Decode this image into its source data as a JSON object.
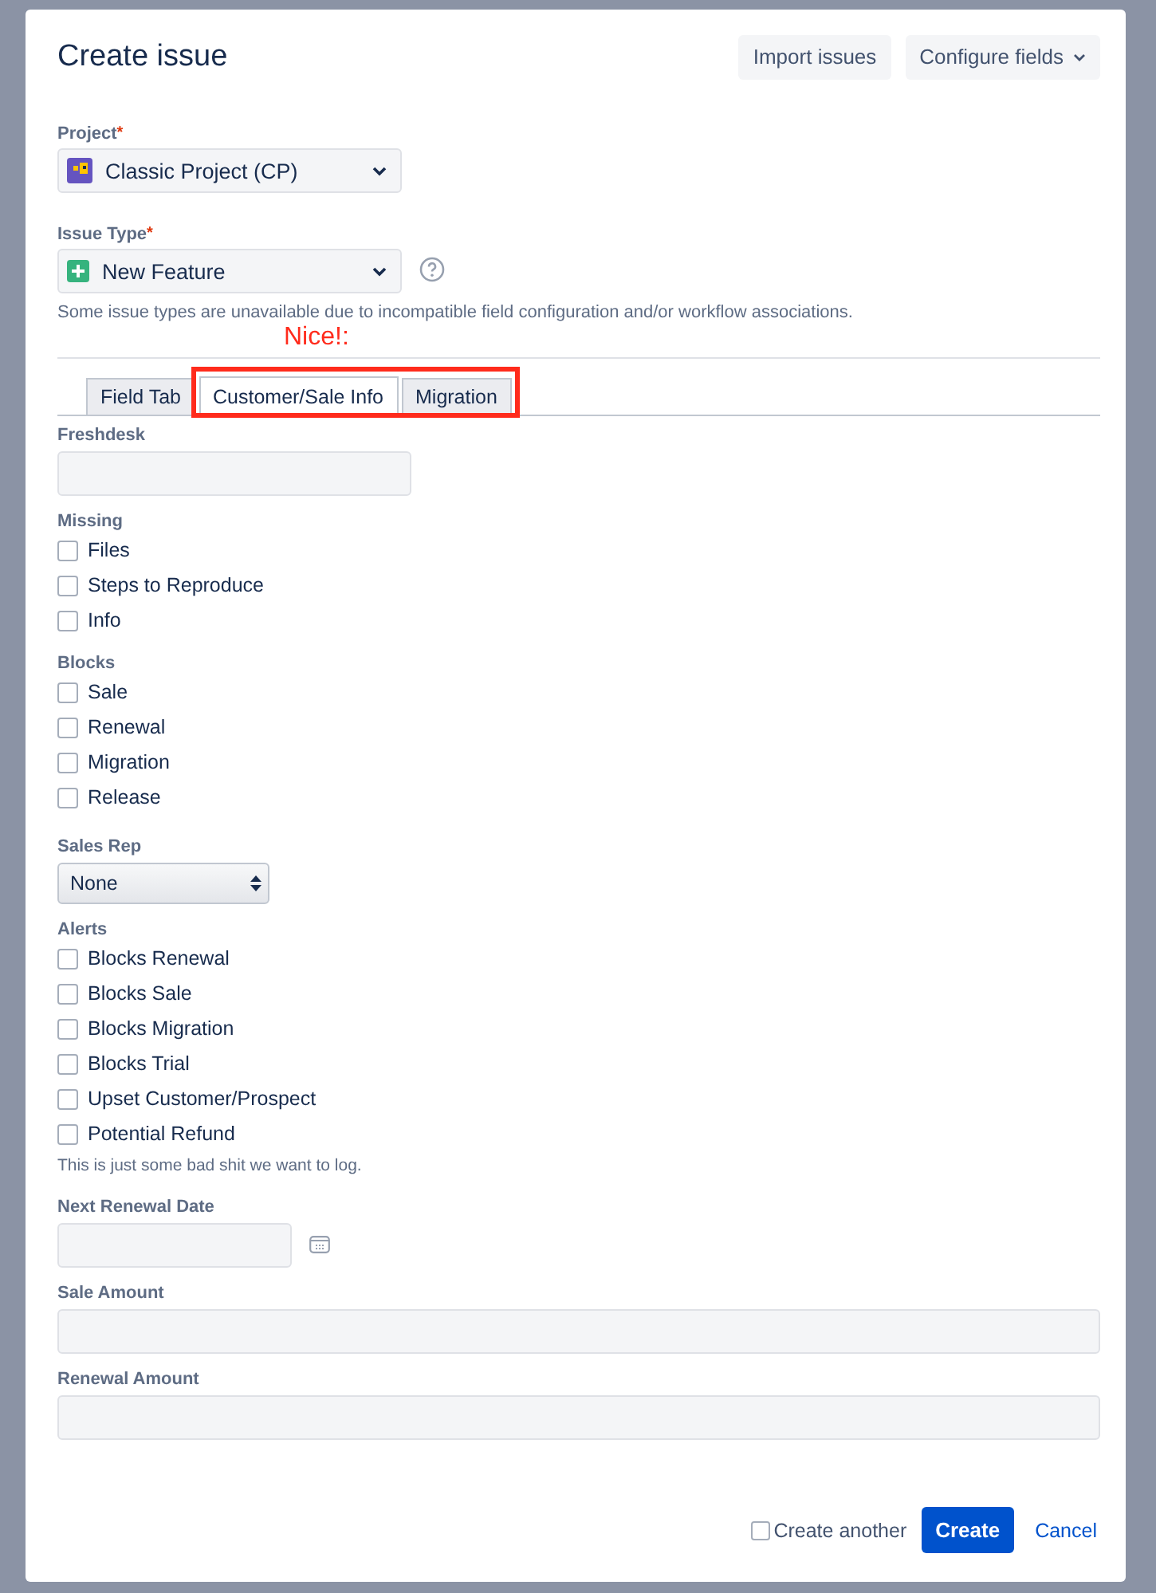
{
  "dialog": {
    "title": "Create issue",
    "header_buttons": [
      {
        "label": "Import issues",
        "dropdown": false
      },
      {
        "label": "Configure fields",
        "dropdown": true
      }
    ],
    "project": {
      "label": "Project",
      "required_mark": "*",
      "value": "Classic Project (CP)"
    },
    "issue_type": {
      "label": "Issue Type",
      "required_mark": "*",
      "value": "New Feature",
      "note": "Some issue types are unavailable due to incompatible field configuration and/or workflow associations."
    },
    "annotation": {
      "text": "Nice!:"
    },
    "tabs": [
      {
        "label": "Field Tab",
        "selected": false
      },
      {
        "label": "Customer/Sale Info",
        "selected": true
      },
      {
        "label": "Migration",
        "selected": false
      }
    ],
    "fields": [
      {
        "kind": "short_text",
        "label": "Freshdesk"
      },
      {
        "kind": "checkboxes",
        "label": "Missing",
        "options": [
          {
            "label": "Files",
            "checked": false
          },
          {
            "label": "Steps to Reproduce",
            "checked": false
          },
          {
            "label": "Info",
            "checked": false
          }
        ]
      },
      {
        "kind": "checkboxes",
        "label": "Blocks",
        "options": [
          {
            "label": "Sale",
            "checked": false
          },
          {
            "label": "Renewal",
            "checked": false
          },
          {
            "label": "Migration",
            "checked": false
          },
          {
            "label": "Release",
            "checked": false
          }
        ]
      },
      {
        "kind": "select",
        "label": "Sales Rep",
        "value": "None"
      },
      {
        "kind": "checkboxes",
        "label": "Alerts",
        "options": [
          {
            "label": "Blocks Renewal",
            "checked": false
          },
          {
            "label": "Blocks Sale",
            "checked": false
          },
          {
            "label": "Blocks Migration",
            "checked": false
          },
          {
            "label": "Blocks Trial",
            "checked": false
          },
          {
            "label": "Upset Customer/Prospect",
            "checked": false
          },
          {
            "label": "Potential Refund",
            "checked": false
          }
        ],
        "help": "This is just some bad shit we want to log."
      },
      {
        "kind": "date",
        "label": "Next Renewal Date"
      },
      {
        "kind": "wide_text",
        "label": "Sale Amount"
      },
      {
        "kind": "wide_text",
        "label": "Renewal Amount"
      }
    ],
    "footer": {
      "create_another": {
        "label": "Create another",
        "checked": false
      },
      "primary": "Create",
      "cancel": "Cancel"
    }
  }
}
